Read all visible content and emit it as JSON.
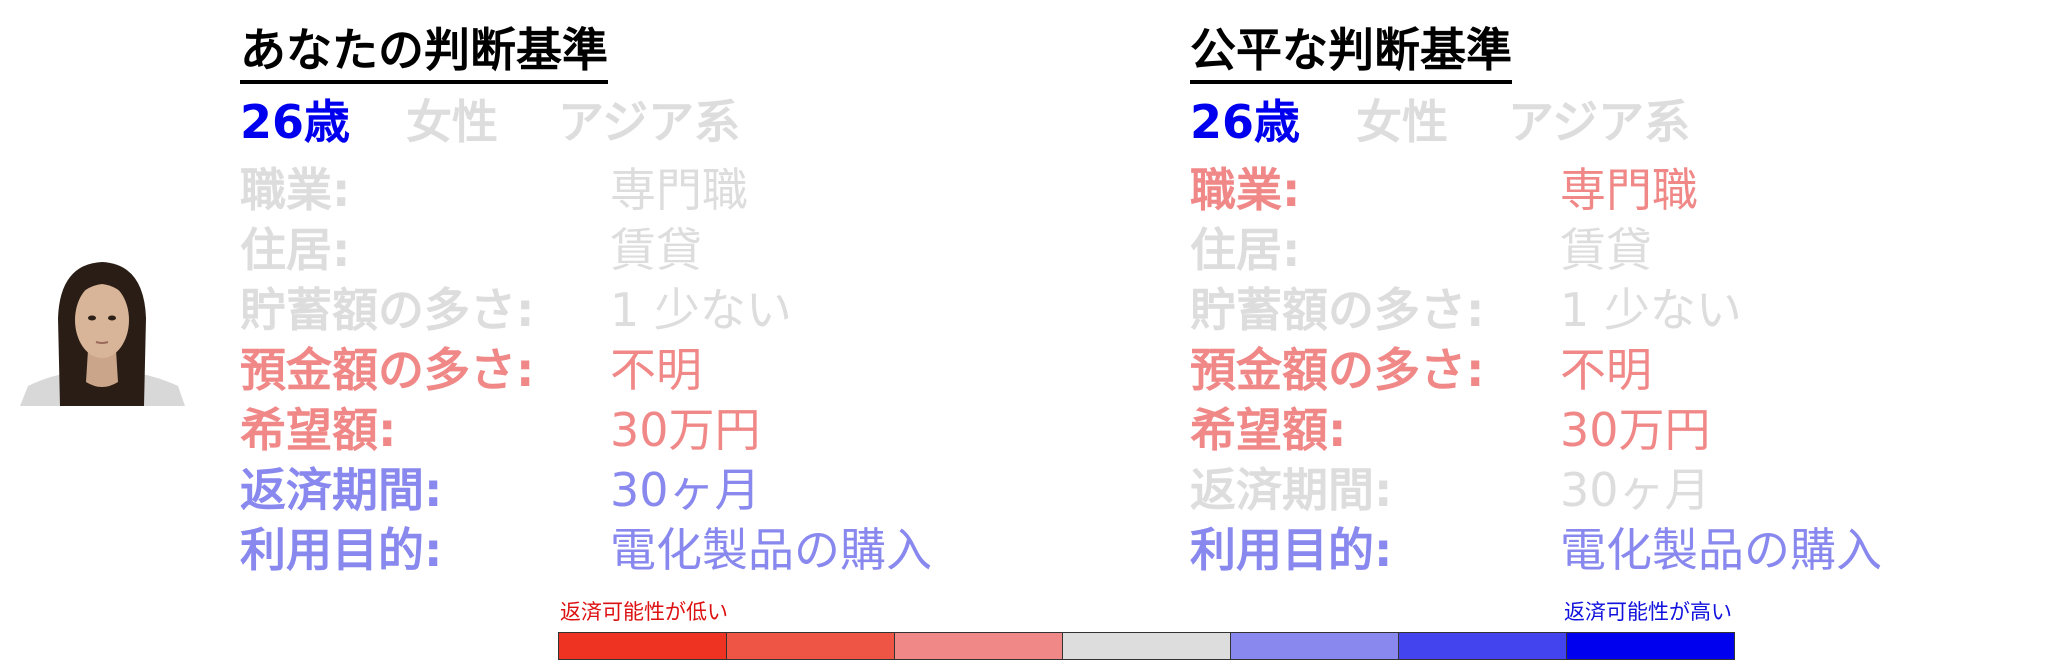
{
  "colors": {
    "neutral": "#dddddd",
    "low": "#f08888",
    "high": "#8888ee",
    "strong_high": "#0000ee"
  },
  "avatar": {
    "icon": "person-photo"
  },
  "left": {
    "title": "あなたの判断基準",
    "demographics": {
      "age": "26歳",
      "age_color": "#0000ee",
      "gender": "女性",
      "gender_color": "#dddddd",
      "ethnicity": "アジア系",
      "ethnicity_color": "#dddddd"
    },
    "rows": [
      {
        "label": "職業:",
        "value": "専門職",
        "color": "#dddddd"
      },
      {
        "label": "住居:",
        "value": "賃貸",
        "color": "#dddddd"
      },
      {
        "label": "貯蓄額の多さ:",
        "value": "1 少ない",
        "color": "#dddddd"
      },
      {
        "label": "預金額の多さ:",
        "value": "不明",
        "color": "#f08888"
      },
      {
        "label": "希望額:",
        "value": "30万円",
        "color": "#f08888"
      },
      {
        "label": "返済期間:",
        "value": "30ヶ月",
        "color": "#8888ee"
      },
      {
        "label": "利用目的:",
        "value": "電化製品の購入",
        "color": "#8888ee"
      }
    ]
  },
  "right": {
    "title": "公平な判断基準",
    "demographics": {
      "age": "26歳",
      "age_color": "#0000ee",
      "gender": "女性",
      "gender_color": "#dddddd",
      "ethnicity": "アジア系",
      "ethnicity_color": "#dddddd"
    },
    "rows": [
      {
        "label": "職業:",
        "value": "専門職",
        "color": "#f08888"
      },
      {
        "label": "住居:",
        "value": "賃貸",
        "color": "#dddddd"
      },
      {
        "label": "貯蓄額の多さ:",
        "value": "1 少ない",
        "color": "#dddddd"
      },
      {
        "label": "預金額の多さ:",
        "value": "不明",
        "color": "#f08888"
      },
      {
        "label": "希望額:",
        "value": "30万円",
        "color": "#f08888"
      },
      {
        "label": "返済期間:",
        "value": "30ヶ月",
        "color": "#dddddd"
      },
      {
        "label": "利用目的:",
        "value": "電化製品の購入",
        "color": "#8888ee"
      }
    ]
  },
  "legend": {
    "low_label": "返済可能性が低い",
    "high_label": "返済可能性が高い",
    "scale_colors": [
      "#ee3322",
      "#ee5544",
      "#f08888",
      "#dddddd",
      "#8888ee",
      "#4444ee",
      "#0000ee"
    ]
  }
}
